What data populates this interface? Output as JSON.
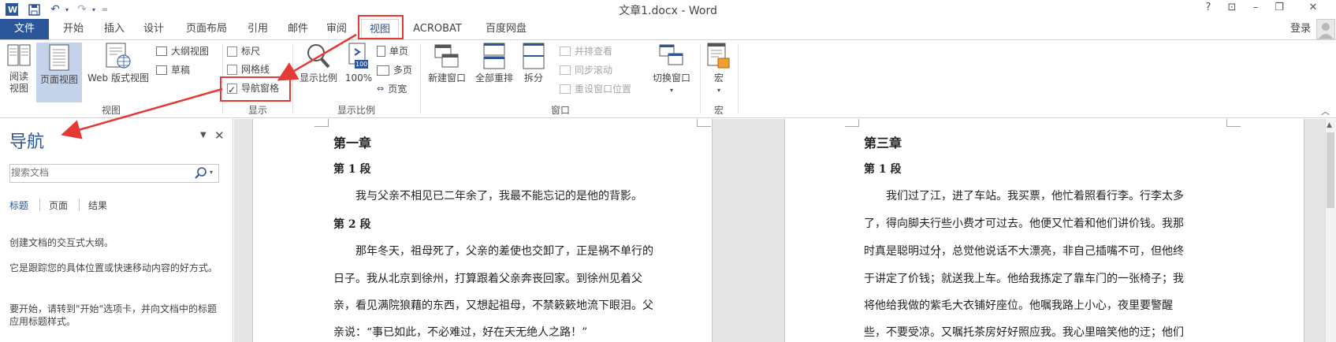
{
  "window": {
    "title": "文章1.docx - Word",
    "help": "?",
    "ribbon_display": "⊡",
    "restore": "❐",
    "close": "✕",
    "sign_in": "登录"
  },
  "quick_access": {
    "more": "="
  },
  "tabs": [
    "文件",
    "开始",
    "插入",
    "设计",
    "页面布局",
    "引用",
    "邮件",
    "审阅",
    "视图",
    "ACROBAT",
    "百度网盘"
  ],
  "active_tab": "视图",
  "ribbon": {
    "views": {
      "group_label": "视图",
      "read_mode": "阅读\n视图",
      "print_layout": "页面视图",
      "web_layout": "Web 版式视图",
      "outline": "大纲视图",
      "draft": "草稿"
    },
    "show": {
      "group_label": "显示",
      "ruler": "标尺",
      "gridlines": "网格线",
      "nav_pane": "导航窗格",
      "ruler_checked": false,
      "gridlines_checked": false,
      "nav_pane_checked": true
    },
    "zoom": {
      "group_label": "显示比例",
      "zoom": "显示比例",
      "hundred": "100%",
      "one_page": "单页",
      "multi_page": "多页",
      "page_width": "页宽",
      "hundred_icon_text": "100"
    },
    "window": {
      "group_label": "窗口",
      "new_window": "新建窗口",
      "arrange_all": "全部重排",
      "split": "拆分",
      "side_by_side": "并排查看",
      "sync_scroll": "同步滚动",
      "reset_position": "重设窗口位置",
      "switch_windows": "切换窗口"
    },
    "macros": {
      "group_label": "宏",
      "macros": "宏"
    }
  },
  "nav_pane": {
    "title": "导航",
    "search_placeholder": "搜索文档",
    "tabs": [
      "标题",
      "页面",
      "结果"
    ],
    "active_tab": "标题",
    "text1": "创建文档的交互式大纲。",
    "text2": "它是跟踪您的具体位置或快速移动内容的好方式。",
    "text3": "要开始，请转到\"开始\"选项卡，并向文档中的标题应用标题样式。"
  },
  "page_left": {
    "chapter": "第一章",
    "sec1": "第 1 段",
    "p1": "我与父亲不相见已二年余了，我最不能忘记的是他的背影。",
    "sec2": "第 2 段",
    "lines": [
      "那年冬天，祖母死了，父亲的差使也交卸了，正是祸不单行的",
      "日子。我从北京到徐州，打算跟着父亲奔丧回家。到徐州见着父",
      "亲，看见满院狼藉的东西，又想起祖母，不禁簌簌地流下眼泪。父",
      "亲说：“事已如此，不必难过，好在天无绝人之路！”"
    ]
  },
  "page_right": {
    "chapter": "第三章",
    "sec1": "第 1 段",
    "lines": [
      "我们过了江，进了车站。我买票，他忙着照看行李。行李太多",
      "了，得向脚夫行些小费才可过去。他便又忙着和他们讲价钱。我那",
      "时真是聪明过分，总觉他说话不大漂亮，非自己插嘴不可，但他终",
      "于讲定了价钱；就送我上车。他给我拣定了靠车门的一张椅子；我",
      "将他给我做的紫毛大衣铺好座位。他嘱我路上小心，夜里要警醒",
      "些，不要受凉。又嘱托茶房好好照应我。我心里暗笑他的迂；他们"
    ]
  },
  "colors": {
    "accent": "#2b579a",
    "annotation": "#e53935"
  }
}
